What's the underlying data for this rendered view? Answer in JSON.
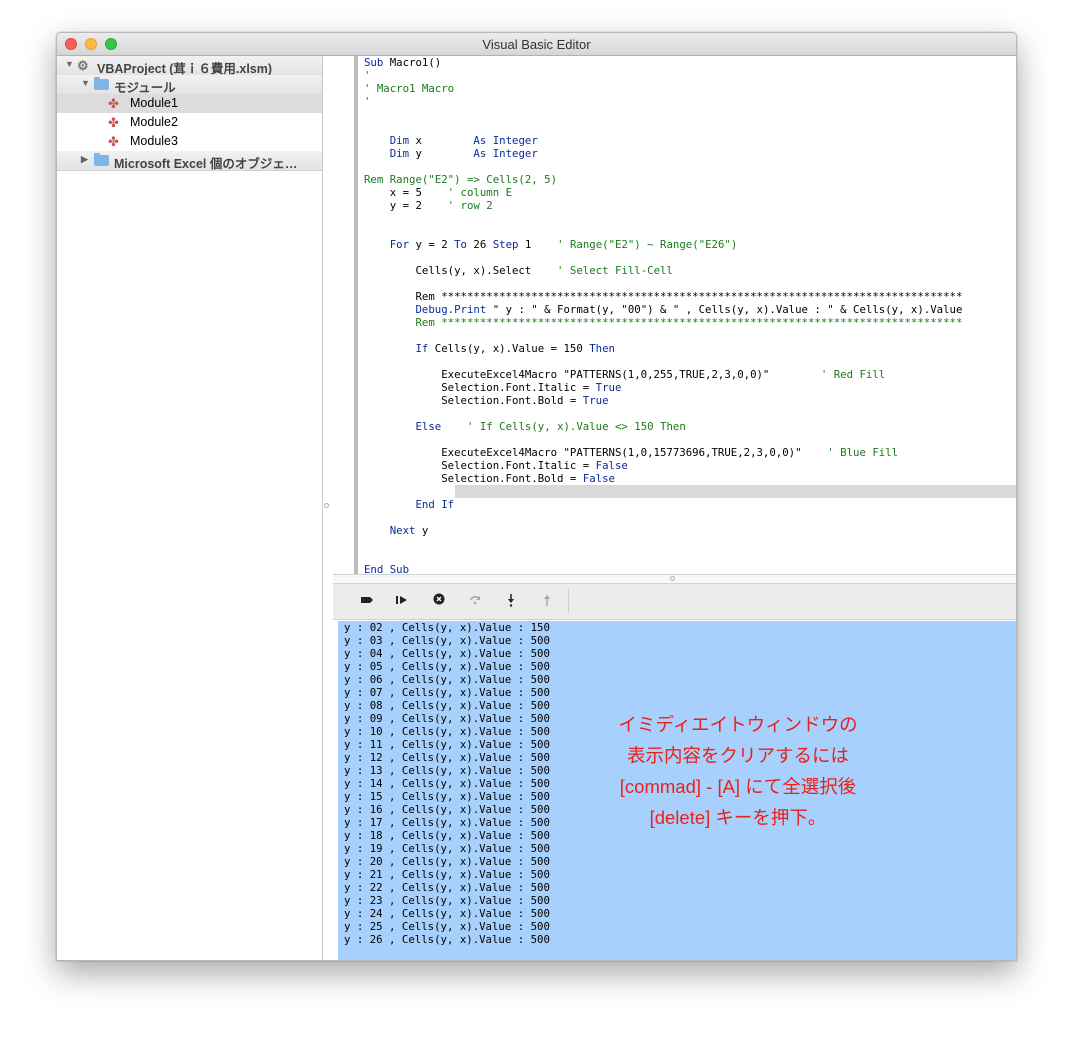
{
  "window": {
    "title": "Visual Basic Editor"
  },
  "project_tree": {
    "project_label": "VBAProject (茸ｉ６費用.xlsm)",
    "modules_folder": "モジュール",
    "modules": [
      "Module1",
      "Module2",
      "Module3"
    ],
    "selected_module": "Module1",
    "excel_objects_folder": "Microsoft Excel 個のオブジェ…"
  },
  "code_lines": [
    [
      {
        "t": "Sub",
        "c": "kw"
      },
      {
        "t": " Macro1()"
      }
    ],
    [
      {
        "t": "'",
        "c": "cm"
      }
    ],
    [
      {
        "t": "' Macro1 Macro",
        "c": "cm"
      }
    ],
    [
      {
        "t": "'",
        "c": "cm"
      }
    ],
    [],
    [],
    [
      {
        "t": "    "
      },
      {
        "t": "Dim",
        "c": "kw"
      },
      {
        "t": " x        "
      },
      {
        "t": "As Integer",
        "c": "kw"
      }
    ],
    [
      {
        "t": "    "
      },
      {
        "t": "Dim",
        "c": "kw"
      },
      {
        "t": " y        "
      },
      {
        "t": "As Integer",
        "c": "kw"
      }
    ],
    [],
    [
      {
        "t": "Rem Range(\"E2\") => Cells(2, 5)",
        "c": "cm"
      }
    ],
    [
      {
        "t": "    x = 5    "
      },
      {
        "t": "' column E",
        "c": "cm"
      }
    ],
    [
      {
        "t": "    y = 2    "
      },
      {
        "t": "' row 2",
        "c": "cm"
      }
    ],
    [],
    [],
    [
      {
        "t": "    "
      },
      {
        "t": "For",
        "c": "kw"
      },
      {
        "t": " y = 2 "
      },
      {
        "t": "To",
        "c": "kw"
      },
      {
        "t": " 26 "
      },
      {
        "t": "Step",
        "c": "kw"
      },
      {
        "t": " 1    "
      },
      {
        "t": "' Range(\"E2\") ~ Range(\"E26\")",
        "c": "cm"
      }
    ],
    [],
    [
      {
        "t": "        Cells(y, x).Select    "
      },
      {
        "t": "' Select Fill-Cell",
        "c": "cm"
      }
    ],
    [],
    [
      {
        "t": "        Rem *********************************************************************************"
      }
    ],
    [
      {
        "t": "        Debug.Print",
        "c": "kw"
      },
      {
        "t": " \" y : \" & Format(y, \"00\") & \" , Cells(y, x).Value : \" & Cells(y, x).Value"
      }
    ],
    [
      {
        "t": "        Rem *********************************************************************************",
        "c": "cm"
      }
    ],
    [],
    [
      {
        "t": "        "
      },
      {
        "t": "If",
        "c": "kw"
      },
      {
        "t": " Cells(y, x).Value = 150 "
      },
      {
        "t": "Then",
        "c": "kw"
      }
    ],
    [],
    [
      {
        "t": "            ExecuteExcel4Macro \"PATTERNS(1,0,255,TRUE,2,3,0,0)\"        "
      },
      {
        "t": "' Red Fill",
        "c": "cm"
      }
    ],
    [
      {
        "t": "            Selection.Font.Italic = "
      },
      {
        "t": "True",
        "c": "kw"
      }
    ],
    [
      {
        "t": "            Selection.Font.Bold = "
      },
      {
        "t": "True",
        "c": "kw"
      }
    ],
    [],
    [
      {
        "t": "        "
      },
      {
        "t": "Else",
        "c": "kw"
      },
      {
        "t": "    "
      },
      {
        "t": "' If Cells(y, x).Value <> 150 Then",
        "c": "cm"
      }
    ],
    [],
    [
      {
        "t": "            ExecuteExcel4Macro \"PATTERNS(1,0,15773696,TRUE,2,3,0,0)\"    "
      },
      {
        "t": "' Blue Fill",
        "c": "cm"
      }
    ],
    [
      {
        "t": "            Selection.Font.Italic = "
      },
      {
        "t": "False",
        "c": "kw"
      }
    ],
    [
      {
        "t": "            Selection.Font.Bold = "
      },
      {
        "t": "False",
        "c": "kw"
      }
    ],
    [],
    [
      {
        "t": "        "
      },
      {
        "t": "End If",
        "c": "kw"
      }
    ],
    [],
    [
      {
        "t": "    "
      },
      {
        "t": "Next",
        "c": "kw"
      },
      {
        "t": " y"
      }
    ],
    [],
    [],
    [
      {
        "t": "End Sub",
        "c": "kw"
      }
    ]
  ],
  "immediate_lines": [
    "y : 02 , Cells(y, x).Value : 150",
    "y : 03 , Cells(y, x).Value : 500",
    "y : 04 , Cells(y, x).Value : 500",
    "y : 05 , Cells(y, x).Value : 500",
    "y : 06 , Cells(y, x).Value : 500",
    "y : 07 , Cells(y, x).Value : 500",
    "y : 08 , Cells(y, x).Value : 500",
    "y : 09 , Cells(y, x).Value : 500",
    "y : 10 , Cells(y, x).Value : 500",
    "y : 11 , Cells(y, x).Value : 500",
    "y : 12 , Cells(y, x).Value : 500",
    "y : 13 , Cells(y, x).Value : 500",
    "y : 14 , Cells(y, x).Value : 500",
    "y : 15 , Cells(y, x).Value : 500",
    "y : 16 , Cells(y, x).Value : 500",
    "y : 17 , Cells(y, x).Value : 500",
    "y : 18 , Cells(y, x).Value : 500",
    "y : 19 , Cells(y, x).Value : 500",
    "y : 20 , Cells(y, x).Value : 500",
    "y : 21 , Cells(y, x).Value : 500",
    "y : 22 , Cells(y, x).Value : 500",
    "y : 23 , Cells(y, x).Value : 500",
    "y : 24 , Cells(y, x).Value : 500",
    "y : 25 , Cells(y, x).Value : 500",
    "y : 26 , Cells(y, x).Value : 500"
  ],
  "annotation": {
    "lines": [
      "イミディエイトウィンドウの",
      "表示内容をクリアするには",
      "[commad] - [A] にて全選択後",
      "[delete] キーを押下。"
    ],
    "color": "#e8221b"
  },
  "debug_toolbar": {
    "buttons": [
      "breakpoint-icon",
      "run-icon",
      "stop-icon",
      "step-over-icon",
      "step-into-icon",
      "step-out-icon"
    ]
  },
  "colors": {
    "keyword": "#0a2a9c",
    "comment": "#1a7a1a",
    "immediate_background": "#a8d0fd"
  }
}
